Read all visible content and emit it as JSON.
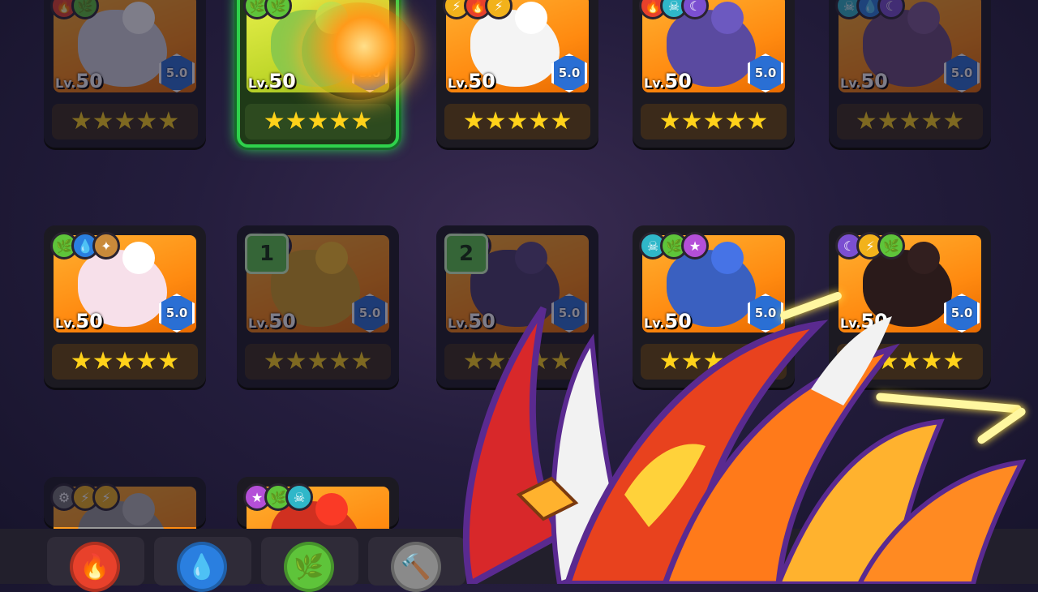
{
  "grid": {
    "row1": [
      {
        "lv_prefix": "Lv.",
        "level": "50",
        "rank": "5.0",
        "stars": "★★★★★",
        "elements": [
          "fire",
          "wind"
        ],
        "variant": "dim",
        "art": "#d8d8e0"
      },
      {
        "lv_prefix": "Lv.",
        "level": "50",
        "rank": "5.0",
        "stars": "★★★★★",
        "elements": [
          "wind",
          "wind"
        ],
        "variant": "green",
        "art": "#8cc94a"
      },
      {
        "lv_prefix": "Lv.",
        "level": "50",
        "rank": "5.0",
        "stars": "★★★★★",
        "elements": [
          "light",
          "fire",
          "light"
        ],
        "variant": "",
        "art": "#f4f4f4"
      },
      {
        "lv_prefix": "Lv.",
        "level": "50",
        "rank": "5.0",
        "stars": "★★★★★",
        "elements": [
          "fire",
          "skull",
          "dark"
        ],
        "variant": "",
        "art": "#5a4aa0"
      },
      {
        "lv_prefix": "Lv.",
        "level": "50",
        "rank": "5.0",
        "stars": "★★★★★",
        "elements": [
          "skull",
          "water",
          "dark"
        ],
        "variant": "dim",
        "art": "#6a4a7a"
      }
    ],
    "row2": [
      {
        "lv_prefix": "Lv.",
        "level": "50",
        "rank": "5.0",
        "stars": "★★★★★",
        "elements": [
          "wind",
          "water",
          "earth"
        ],
        "variant": "",
        "art": "#f7e0ea",
        "slot": ""
      },
      {
        "lv_prefix": "Lv.",
        "level": "50",
        "rank": "5.0",
        "stars": "★★★★★",
        "elements": [
          "dark",
          "dark"
        ],
        "variant": "dim",
        "art": "#d8a020",
        "slot": "1"
      },
      {
        "lv_prefix": "Lv.",
        "level": "50",
        "rank": "5.0",
        "stars": "★★★★★",
        "elements": [
          "dark",
          "star"
        ],
        "variant": "dim",
        "art": "#4a3a6a",
        "slot": "2"
      },
      {
        "lv_prefix": "Lv.",
        "level": "50",
        "rank": "5.0",
        "stars": "★★★★★",
        "elements": [
          "skull",
          "wind",
          "star"
        ],
        "variant": "",
        "art": "#3a60c0",
        "slot": ""
      },
      {
        "lv_prefix": "Lv.",
        "level": "50",
        "rank": "5.0",
        "stars": "★★★★★",
        "elements": [
          "dark",
          "light",
          "wind"
        ],
        "variant": "",
        "art": "#2a1a1a",
        "slot": ""
      }
    ],
    "row3": [
      {
        "elements": [
          "steel",
          "light",
          "light"
        ],
        "variant": "dim",
        "art": "#9a9a9a"
      },
      {
        "elements": [
          "star",
          "wind",
          "skull"
        ],
        "variant": "",
        "art": "#d03020"
      }
    ]
  },
  "tabs": [
    {
      "name": "fire",
      "color": "#e8412b",
      "glyph": "🔥"
    },
    {
      "name": "water",
      "color": "#2a7fe0",
      "glyph": "💧"
    },
    {
      "name": "wind",
      "color": "#5ec43a",
      "glyph": "🌿"
    },
    {
      "name": "steel",
      "color": "#8a8a8a",
      "glyph": "🔨"
    }
  ],
  "colors": {
    "accent_green": "#2fd14c",
    "hex_blue": "#2a6fd4",
    "star_yellow": "#ffd21a"
  }
}
